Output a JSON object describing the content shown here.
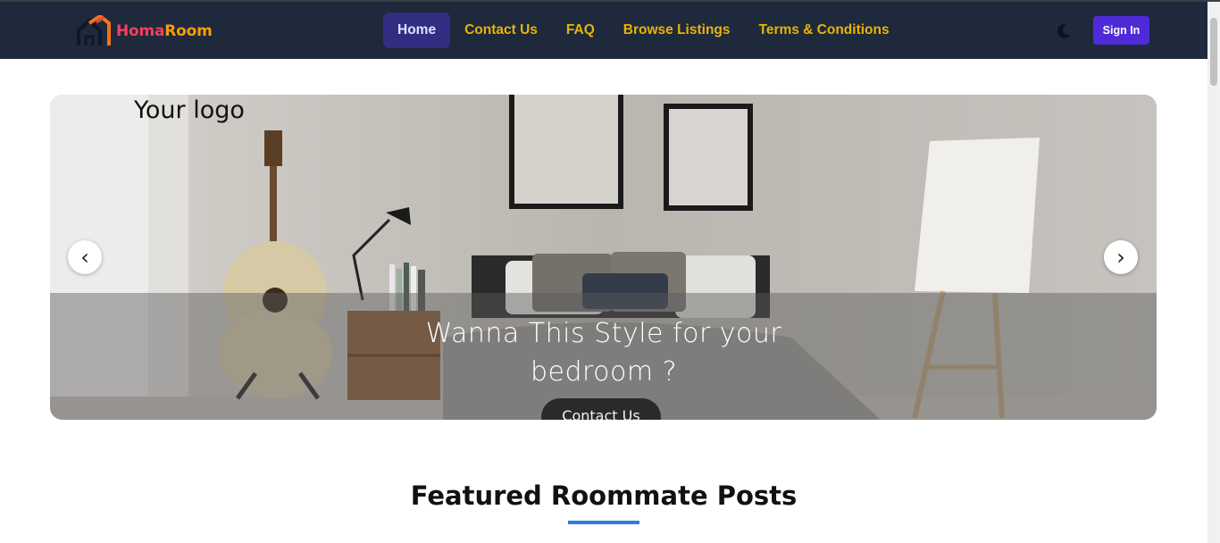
{
  "brand": {
    "name_part1": "Homa",
    "name_part2": "Room"
  },
  "nav": {
    "links": [
      {
        "label": "Home",
        "active": true
      },
      {
        "label": "Contact Us",
        "active": false
      },
      {
        "label": "FAQ",
        "active": false
      },
      {
        "label": "Browse Listings",
        "active": false
      },
      {
        "label": "Terms & Conditions",
        "active": false
      }
    ],
    "theme_toggle_icon": "moon-icon",
    "signin_label": "Sign In"
  },
  "hero": {
    "logo_text": "Your logo",
    "caption": "Wanna This Style for your bedroom ?",
    "button_label": "Contact Us",
    "prev_arrow": "‹",
    "next_arrow": "›"
  },
  "featured": {
    "title": "Featured Roommate Posts"
  },
  "colors": {
    "navbar_bg": "#1e293b",
    "nav_link": "#eab308",
    "nav_active_bg": "#312e81",
    "signin_bg": "#4f2bd8",
    "brand_pink": "#f43f5e",
    "brand_orange": "#f59e0b",
    "underline": "#2f7de1"
  }
}
